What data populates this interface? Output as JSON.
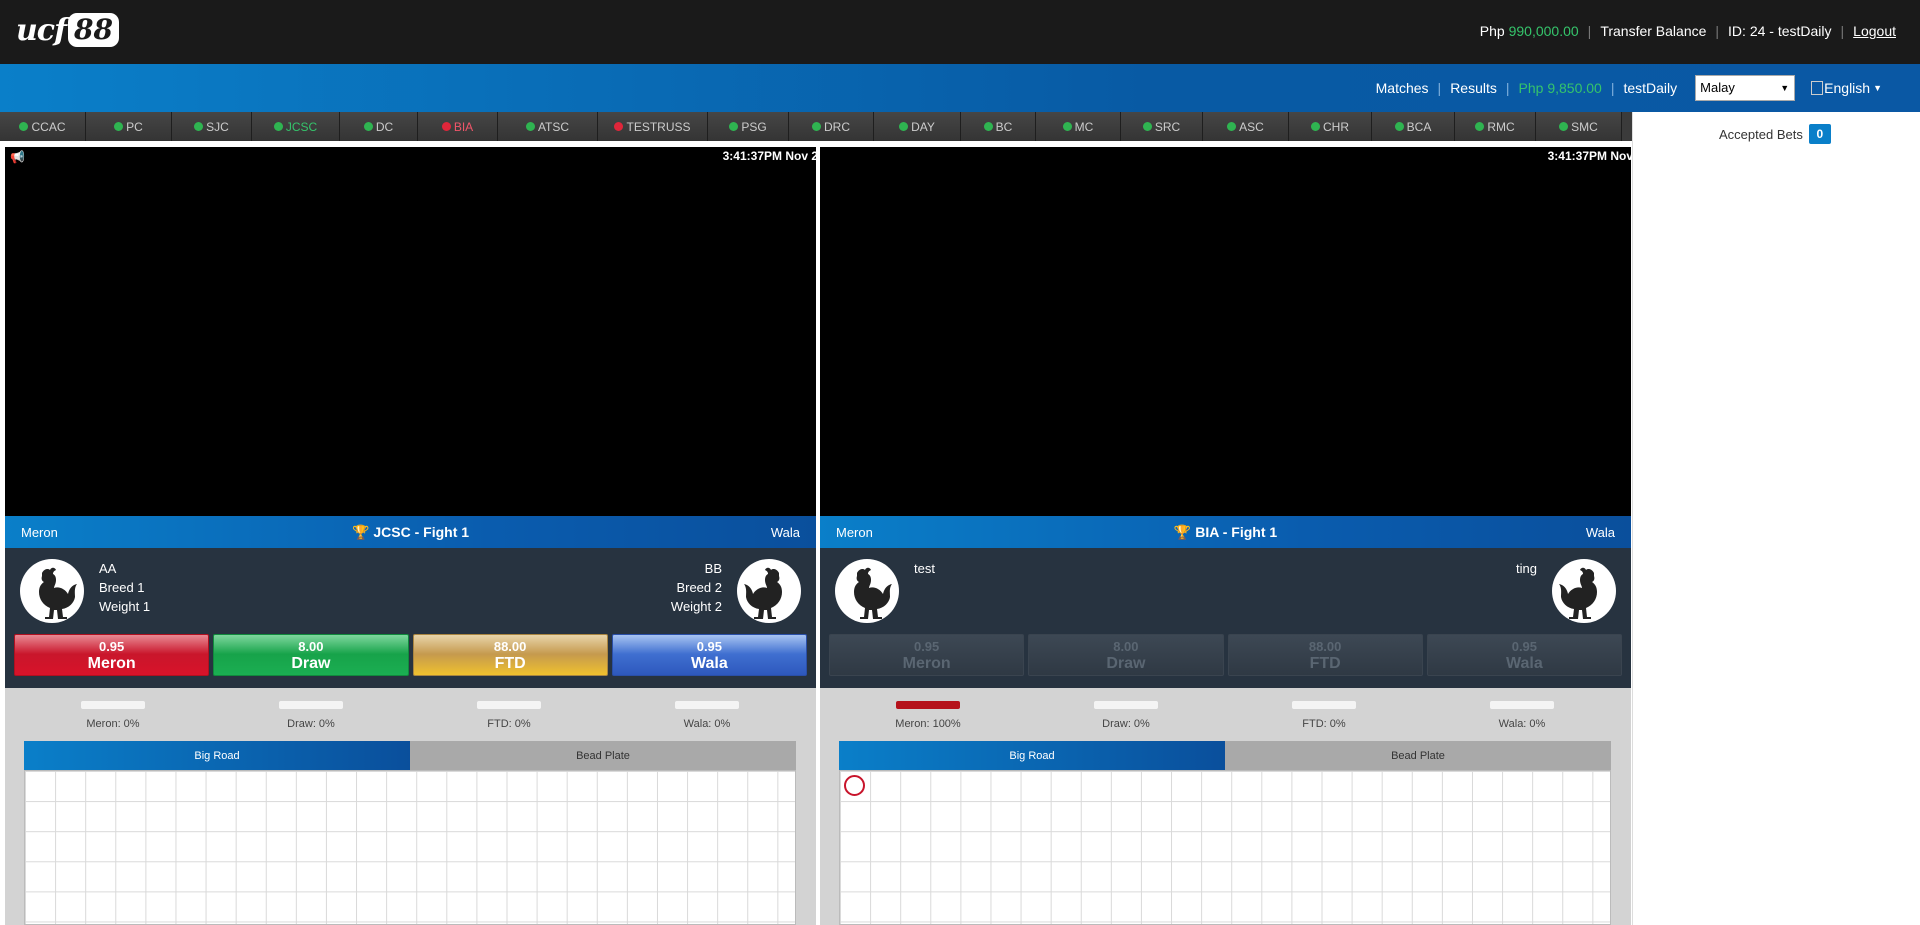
{
  "header": {
    "logo_text": "ucf",
    "logo_number": "88",
    "currency": "Php",
    "balance": "990,000.00",
    "transfer_label": "Transfer Balance",
    "user_id": "ID: 24 - testDaily",
    "logout_label": "Logout"
  },
  "nav": {
    "matches_label": "Matches",
    "results_label": "Results",
    "wallet_currency": "Php",
    "wallet_balance": "9,850.00",
    "username": "testDaily",
    "language_select_value": "Malay",
    "language_flag_alt": "English"
  },
  "arenas": [
    {
      "label": "CCAC",
      "status": "green",
      "width": 86
    },
    {
      "label": "PC",
      "status": "green",
      "width": 86
    },
    {
      "label": "SJC",
      "status": "green",
      "width": 80
    },
    {
      "label": "JCSC",
      "status": "green",
      "active": true,
      "width": 88
    },
    {
      "label": "DC",
      "status": "green",
      "width": 78
    },
    {
      "label": "BIA",
      "status": "red",
      "live": true,
      "width": 80
    },
    {
      "label": "ATSC",
      "status": "green",
      "width": 100
    },
    {
      "label": "TESTRUSS",
      "status": "red",
      "width": 110
    },
    {
      "label": "PSG",
      "status": "green",
      "width": 81
    },
    {
      "label": "DRC",
      "status": "green",
      "width": 85
    },
    {
      "label": "DAY",
      "status": "green",
      "width": 87
    },
    {
      "label": "BC",
      "status": "green",
      "width": 75
    },
    {
      "label": "MC",
      "status": "green",
      "width": 85
    },
    {
      "label": "SRC",
      "status": "green",
      "width": 82
    },
    {
      "label": "ASC",
      "status": "green",
      "width": 86
    },
    {
      "label": "CHR",
      "status": "green",
      "width": 83
    },
    {
      "label": "BCA",
      "status": "green",
      "width": 83
    },
    {
      "label": "RMC",
      "status": "green",
      "width": 81
    },
    {
      "label": "SMC",
      "status": "green",
      "width": 86
    }
  ],
  "sidebar": {
    "accepted_bets_label": "Accepted Bets",
    "accepted_bets_count": "0"
  },
  "panels": [
    {
      "clock": "3:41:37PM Nov 2",
      "meron_side": "Meron",
      "wala_side": "Wala",
      "fight_title": "JCSC - Fight 1",
      "left_fighter": [
        "AA",
        "Breed 1",
        "Weight 1"
      ],
      "right_fighter": [
        "BB",
        "Breed 2",
        "Weight 2"
      ],
      "bets_enabled": true,
      "bets": [
        {
          "odds": "0.95",
          "name": "Meron"
        },
        {
          "odds": "8.00",
          "name": "Draw"
        },
        {
          "odds": "88.00",
          "name": "FTD"
        },
        {
          "odds": "0.95",
          "name": "Wala"
        }
      ],
      "stats": [
        {
          "label": "Meron: 0%",
          "pct": 0
        },
        {
          "label": "Draw: 0%",
          "pct": 0
        },
        {
          "label": "FTD: 0%",
          "pct": 0
        },
        {
          "label": "Wala: 0%",
          "pct": 0
        }
      ],
      "road_tabs": [
        "Big Road",
        "Bead Plate"
      ],
      "road_marks": []
    },
    {
      "clock": "3:41:37PM Nov",
      "meron_side": "Meron",
      "wala_side": "Wala",
      "fight_title": "BIA - Fight 1",
      "left_fighter": [
        "test"
      ],
      "right_fighter": [
        "ting"
      ],
      "bets_enabled": false,
      "bets": [
        {
          "odds": "0.95",
          "name": "Meron"
        },
        {
          "odds": "8.00",
          "name": "Draw"
        },
        {
          "odds": "88.00",
          "name": "FTD"
        },
        {
          "odds": "0.95",
          "name": "Wala"
        }
      ],
      "stats": [
        {
          "label": "Meron: 100%",
          "pct": 100
        },
        {
          "label": "Draw: 0%",
          "pct": 0
        },
        {
          "label": "FTD: 0%",
          "pct": 0
        },
        {
          "label": "Wala: 0%",
          "pct": 0
        }
      ],
      "road_tabs": [
        "Big Road",
        "Bead Plate"
      ],
      "road_marks": [
        "meron"
      ]
    }
  ]
}
